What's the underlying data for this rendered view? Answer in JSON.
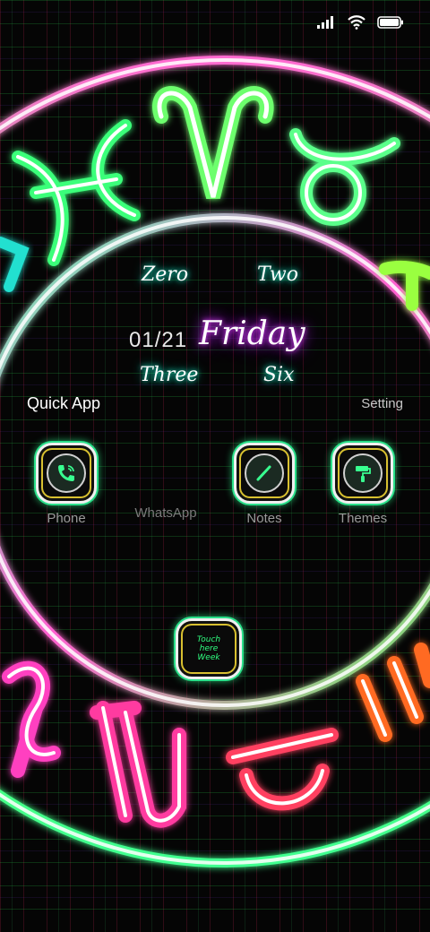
{
  "status_bar": {
    "icons": [
      "signal-icon",
      "wifi-icon",
      "battery-icon"
    ]
  },
  "clock_words": {
    "hour_tens": "Zero",
    "hour_ones": "Two",
    "minute_tens": "Three",
    "minute_ones": "Six"
  },
  "date": "01/21",
  "weekday": "Friday",
  "quick_app_label": "Quick App",
  "setting_label": "Setting",
  "apps": [
    {
      "label": "Phone",
      "icon": "phone-icon"
    },
    {
      "label": "WhatsApp",
      "icon": ""
    },
    {
      "label": "Notes",
      "icon": "pen-icon"
    },
    {
      "label": "Themes",
      "icon": "paint-roller-icon"
    }
  ],
  "touch_button": {
    "text": "Touch here Week"
  },
  "colors": {
    "ring": "#ffffff",
    "neon_green": "#30ff80",
    "neon_pink": "#ff3aa0",
    "neon_purple": "#c040ff",
    "neon_cyan": "#1ef0d0"
  }
}
